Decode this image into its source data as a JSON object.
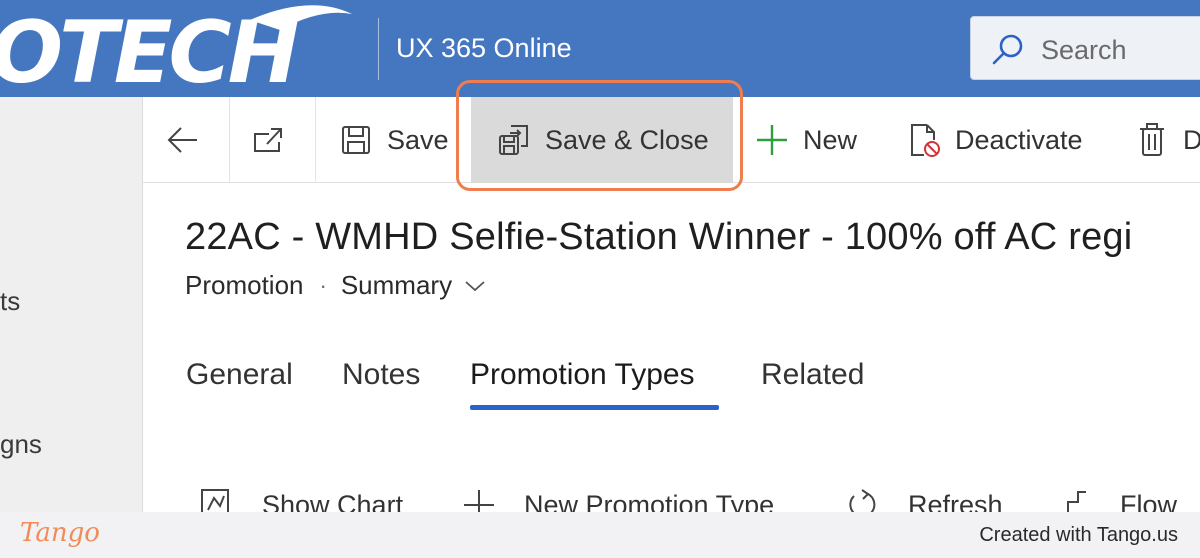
{
  "banner": {
    "logo_text": "OTECH",
    "app_title": "UX 365 Online",
    "search_placeholder": "Search"
  },
  "left_nav": {
    "items": [
      "ts",
      "gns"
    ]
  },
  "command_bar": {
    "back_icon": "arrow-left-icon",
    "popout_icon": "open-in-new-window-icon",
    "save_label": "Save",
    "save_close_label": "Save & Close",
    "new_label": "New",
    "deactivate_label": "Deactivate",
    "delete_label_fragment": "D"
  },
  "record": {
    "title": "22AC - WMHD Selfie-Station Winner - 100% off AC regi",
    "entity": "Promotion",
    "separator": "·",
    "view": "Summary"
  },
  "tabs": [
    {
      "label": "General",
      "active": false
    },
    {
      "label": "Notes",
      "active": false
    },
    {
      "label": "Promotion Types",
      "active": true
    },
    {
      "label": "Related",
      "active": false
    }
  ],
  "subgrid_toolbar": {
    "show_chart": "Show Chart",
    "new_promotion_type": "New Promotion Type",
    "refresh": "Refresh",
    "flow": "Flow"
  },
  "footer": {
    "brand": "Tango",
    "credit": "Created with Tango.us"
  },
  "colors": {
    "banner": "#4577c0",
    "highlight": "#ef7d50",
    "active_tab_underline": "#2a62c9",
    "new_plus": "#2e9e3e"
  }
}
